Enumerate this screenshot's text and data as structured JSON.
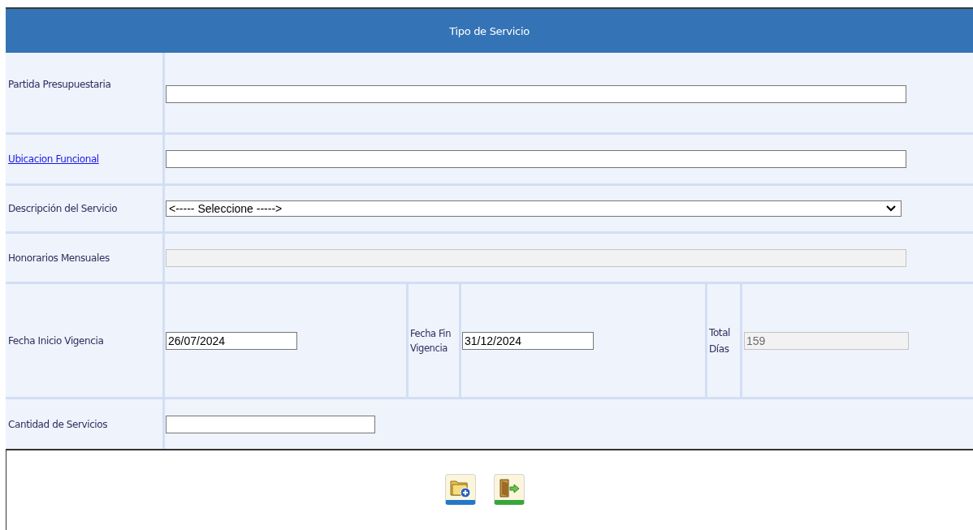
{
  "title": "Tipo de Servicio",
  "rows": [
    {
      "fields": [
        {
          "label": "Partida Presupuestaria",
          "link": false,
          "kind": "text",
          "disabled": false
        }
      ]
    },
    {
      "fields": [
        {
          "label": "Ubicacion Funcional",
          "link": true,
          "kind": "text",
          "disabled": false
        }
      ]
    },
    {
      "fields": [
        {
          "label": "Descripción del Servicio",
          "link": false,
          "kind": "select",
          "disabled": false,
          "value": "<----- Seleccione ----->"
        }
      ]
    },
    {
      "fields": [
        {
          "label": "Honorarios Mensuales",
          "link": false,
          "kind": "text",
          "disabled": true
        }
      ]
    },
    {
      "fields": [
        {
          "label": "Fecha Inicio Vigencia",
          "link": false,
          "kind": "date",
          "disabled": false,
          "value": "26/07/2024"
        },
        {
          "label": "Fecha Fin Vigencia",
          "link": false,
          "kind": "date",
          "disabled": false,
          "value": "31/12/2024"
        },
        {
          "label": "Total Días",
          "link": false,
          "kind": "number",
          "disabled": true,
          "value": "159"
        }
      ]
    },
    {
      "fields": [
        {
          "label": "Cantidad de Servicios",
          "link": false,
          "kind": "number",
          "disabled": false
        }
      ]
    }
  ],
  "actions": [
    {
      "kind": "new"
    },
    {
      "kind": "exit"
    }
  ]
}
